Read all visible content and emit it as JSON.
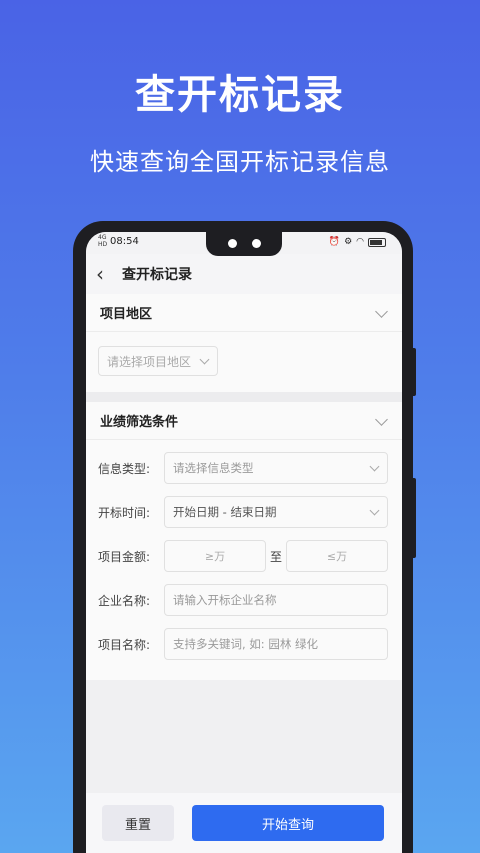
{
  "hero": {
    "title": "查开标记录",
    "subtitle": "快速查询全国开标记录信息"
  },
  "status_bar": {
    "network": "4G\nHD",
    "time": "08:54"
  },
  "nav": {
    "back_icon": "chevron-left-icon",
    "title": "查开标记录"
  },
  "region_section": {
    "label": "项目地区",
    "select_placeholder": "请选择项目地区"
  },
  "filter_section": {
    "label": "业绩筛选条件",
    "rows": {
      "info_type": {
        "label": "信息类型:",
        "placeholder": "请选择信息类型"
      },
      "open_time": {
        "label": "开标时间:",
        "value": "开始日期 - 结束日期"
      },
      "amount": {
        "label": "项目金额:",
        "min": "≥万",
        "to": "至",
        "max": "≤万"
      },
      "company": {
        "label": "企业名称:",
        "placeholder": "请输入开标企业名称"
      },
      "project": {
        "label": "项目名称:",
        "placeholder": "支持多关键词, 如: 园林 绿化"
      }
    }
  },
  "actions": {
    "reset": "重置",
    "search": "开始查询"
  },
  "colors": {
    "primary": "#2e6bf0",
    "background_top": "#4a63e6",
    "background_bottom": "#5aa6f0"
  }
}
